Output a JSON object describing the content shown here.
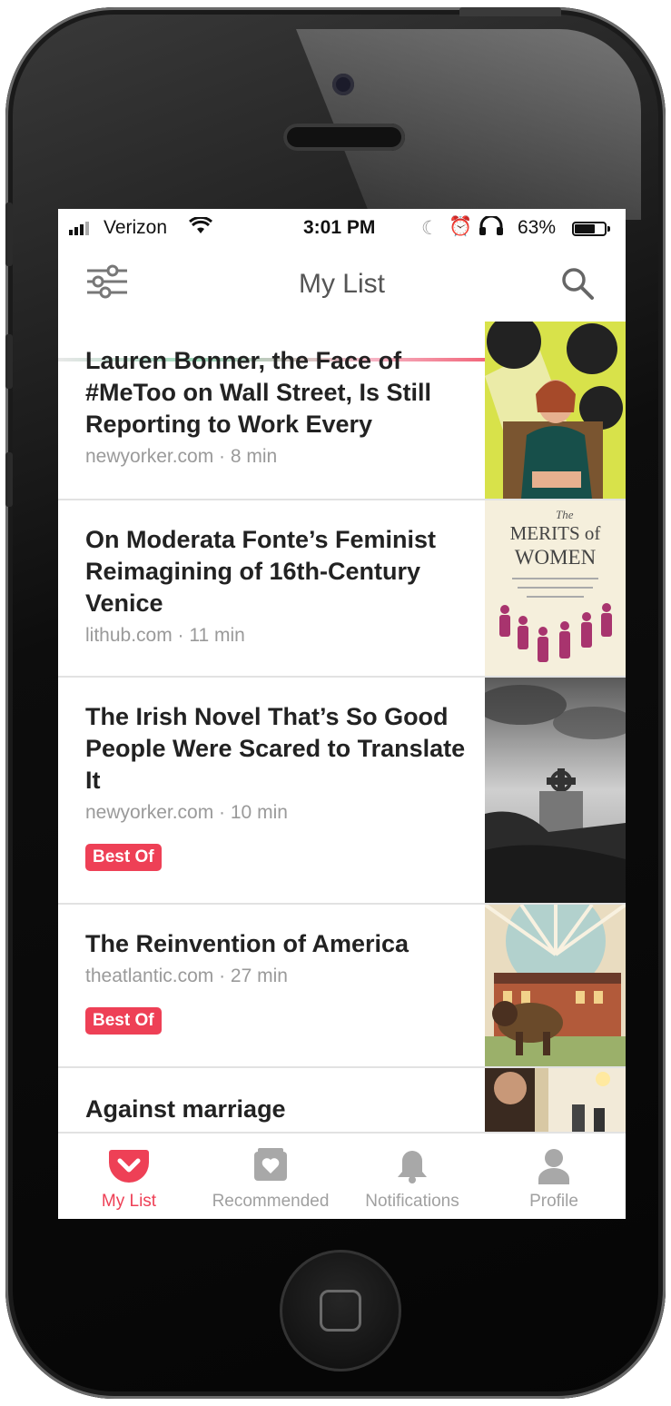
{
  "status_bar": {
    "carrier": "Verizon",
    "time": "3:01 PM",
    "battery_percent": "63%"
  },
  "nav": {
    "title": "My List"
  },
  "articles": [
    {
      "title": "Lauren Bonner, the Face of #MeToo on Wall Street, Is Still Reporting to Work Every",
      "meta": "newyorker.com · 8 min",
      "badge": ""
    },
    {
      "title": "On Moderata Fonte’s Feminist Reimagining of 16th-Century Venice",
      "meta": "lithub.com · 11 min",
      "badge": ""
    },
    {
      "title": "The Irish Novel That’s So Good People Were Scared to Translate It",
      "meta": "newyorker.com · 10 min",
      "badge": "Best Of"
    },
    {
      "title": "The Reinvention of America",
      "meta": "theatlantic.com · 27 min",
      "badge": "Best Of"
    },
    {
      "title": "Against marriage",
      "meta": "",
      "badge": ""
    }
  ],
  "book_cover": {
    "line1": "The",
    "line2": "MERITS of",
    "line3": "WOMEN"
  },
  "tabs": [
    {
      "label": "My List",
      "icon": "pocket-icon",
      "active": true
    },
    {
      "label": "Recommended",
      "icon": "heart-box-icon",
      "active": false
    },
    {
      "label": "Notifications",
      "icon": "bell-icon",
      "active": false
    },
    {
      "label": "Profile",
      "icon": "person-icon",
      "active": false
    }
  ],
  "colors": {
    "accent": "#ee4056",
    "inactive": "#a0a0a0"
  }
}
